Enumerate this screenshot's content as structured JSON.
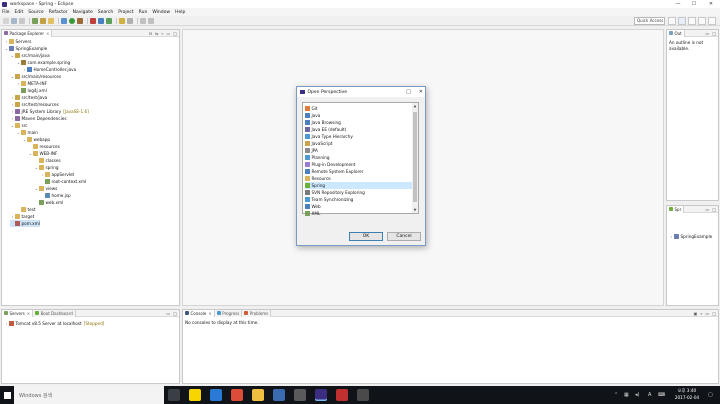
{
  "window": {
    "title": "workspace - Spring - Eclipse",
    "controls": [
      "—",
      "☐",
      "✕"
    ]
  },
  "menu": [
    "File",
    "Edit",
    "Source",
    "Refactor",
    "Navigate",
    "Search",
    "Project",
    "Run",
    "Window",
    "Help"
  ],
  "toolbar": {
    "quick_access": "Quick Access"
  },
  "package_explorer": {
    "tab": "Package Explorer",
    "tree": [
      {
        "label": "Servers",
        "depth": 0,
        "twisty": "›",
        "icon": "folder-icon",
        "color": "#d9b45a"
      },
      {
        "label": "SpringExample",
        "depth": 0,
        "twisty": "⌄",
        "icon": "project-icon",
        "color": "#6a7fb0"
      },
      {
        "label": "src/main/java",
        "depth": 1,
        "twisty": "⌄",
        "icon": "source-folder-icon",
        "color": "#c9a54a"
      },
      {
        "label": "com.example.spring",
        "depth": 2,
        "twisty": "⌄",
        "icon": "package-icon",
        "color": "#9a7b3a"
      },
      {
        "label": "HomeController.java",
        "depth": 3,
        "twisty": "›",
        "icon": "java-file-icon",
        "color": "#4a7fc0"
      },
      {
        "label": "src/main/resources",
        "depth": 1,
        "twisty": "⌄",
        "icon": "source-folder-icon",
        "color": "#c9a54a"
      },
      {
        "label": "META-INF",
        "depth": 2,
        "twisty": "›",
        "icon": "folder-icon",
        "color": "#d9b45a"
      },
      {
        "label": "log4j.xml",
        "depth": 2,
        "twisty": "",
        "icon": "xml-file-icon",
        "color": "#7a9f5a"
      },
      {
        "label": "src/test/java",
        "depth": 1,
        "twisty": "›",
        "icon": "source-folder-icon",
        "color": "#c9a54a"
      },
      {
        "label": "src/test/resources",
        "depth": 1,
        "twisty": "›",
        "icon": "source-folder-icon",
        "color": "#c9a54a"
      },
      {
        "label": "JRE System Library",
        "deco": "[JavaSE-1.6]",
        "depth": 1,
        "twisty": "›",
        "icon": "library-icon",
        "color": "#8a6aa0"
      },
      {
        "label": "Maven Dependencies",
        "depth": 1,
        "twisty": "›",
        "icon": "library-icon",
        "color": "#8a6aa0"
      },
      {
        "label": "src",
        "depth": 1,
        "twisty": "⌄",
        "icon": "folder-icon",
        "color": "#d9b45a"
      },
      {
        "label": "main",
        "depth": 2,
        "twisty": "⌄",
        "icon": "folder-icon",
        "color": "#d9b45a"
      },
      {
        "label": "webapp",
        "depth": 3,
        "twisty": "⌄",
        "icon": "folder-icon",
        "color": "#d9b45a"
      },
      {
        "label": "resources",
        "depth": 4,
        "twisty": "",
        "icon": "folder-icon",
        "color": "#d9b45a"
      },
      {
        "label": "WEB-INF",
        "depth": 4,
        "twisty": "⌄",
        "icon": "folder-icon",
        "color": "#d9b45a"
      },
      {
        "label": "classes",
        "depth": 5,
        "twisty": "",
        "icon": "folder-icon",
        "color": "#d9b45a"
      },
      {
        "label": "spring",
        "depth": 5,
        "twisty": "⌄",
        "icon": "folder-icon",
        "color": "#d9b45a"
      },
      {
        "label": "appServlet",
        "depth": 6,
        "twisty": "›",
        "icon": "folder-icon",
        "color": "#d9b45a"
      },
      {
        "label": "root-context.xml",
        "depth": 6,
        "twisty": "",
        "icon": "xml-file-icon",
        "color": "#7a9f5a"
      },
      {
        "label": "views",
        "depth": 5,
        "twisty": "⌄",
        "icon": "folder-icon",
        "color": "#d9b45a"
      },
      {
        "label": "home.jsp",
        "depth": 6,
        "twisty": "",
        "icon": "jsp-file-icon",
        "color": "#5a8ab0"
      },
      {
        "label": "web.xml",
        "depth": 5,
        "twisty": "",
        "icon": "xml-file-icon",
        "color": "#7a9f5a"
      },
      {
        "label": "test",
        "depth": 2,
        "twisty": "",
        "icon": "folder-icon",
        "color": "#d9b45a"
      },
      {
        "label": "target",
        "depth": 1,
        "twisty": "›",
        "icon": "folder-icon",
        "color": "#d9b45a"
      },
      {
        "label": "pom.xml",
        "depth": 1,
        "twisty": "",
        "icon": "maven-file-icon",
        "color": "#b05a5a",
        "selected": true
      }
    ]
  },
  "outline": {
    "tab": "Out",
    "message": "An outline is not available."
  },
  "spring_explorer": {
    "tab": "Spr",
    "item": "SpringExample"
  },
  "servers": {
    "tabs": [
      "Servers",
      "Boot Dashboard"
    ],
    "row": "Tomcat v8.5 Server at localhost",
    "status": "[Stopped]"
  },
  "console": {
    "tabs": [
      "Console",
      "Progress",
      "Problems"
    ],
    "message": "No consoles to display at this time."
  },
  "dialog": {
    "title": "Open Perspective",
    "controls": [
      "□",
      "✕"
    ],
    "perspectives": [
      {
        "label": "Git",
        "color": "#e07a3a"
      },
      {
        "label": "Java",
        "color": "#4a7fc0"
      },
      {
        "label": "Java Browsing",
        "color": "#4a7fc0"
      },
      {
        "label": "Java EE (default)",
        "color": "#6a6aa0"
      },
      {
        "label": "Java Type Hierarchy",
        "color": "#4a9ad0"
      },
      {
        "label": "JavaScript",
        "color": "#c9a54a"
      },
      {
        "label": "JPA",
        "color": "#8a8a8a"
      },
      {
        "label": "Planning",
        "color": "#4a9ad0"
      },
      {
        "label": "Plug-in Development",
        "color": "#9a7bd0"
      },
      {
        "label": "Remote System Explorer",
        "color": "#4a7fc0"
      },
      {
        "label": "Resource",
        "color": "#d9b45a"
      },
      {
        "label": "Spring",
        "color": "#6aaf3a",
        "selected": true
      },
      {
        "label": "SVN Repository Exploring",
        "color": "#7a7a7a"
      },
      {
        "label": "Team Synchronizing",
        "color": "#4a9ad0"
      },
      {
        "label": "Web",
        "color": "#4a7fc0"
      },
      {
        "label": "XML",
        "color": "#7a9f5a"
      }
    ],
    "ok": "OK",
    "cancel": "Cancel"
  },
  "taskbar": {
    "search": "Windows 검색",
    "time": "오후 3:40",
    "date": "2017-02-04",
    "apps": [
      {
        "name": "task-view-icon",
        "color": "#3a3f45"
      },
      {
        "name": "kakaotalk-icon",
        "color": "#f6d500"
      },
      {
        "name": "edge-icon",
        "color": "#2a7ad5"
      },
      {
        "name": "chrome-icon",
        "color": "#dd4b39"
      },
      {
        "name": "file-explorer-icon",
        "color": "#f0c040"
      },
      {
        "name": "store-icon",
        "color": "#3a6ab0"
      },
      {
        "name": "app-icon",
        "color": "#5a5a5a"
      },
      {
        "name": "eclipse-icon",
        "color": "#3b2d80"
      },
      {
        "name": "camera-icon",
        "color": "#c03030"
      },
      {
        "name": "app-icon-2",
        "color": "#4a4a4a"
      }
    ]
  }
}
